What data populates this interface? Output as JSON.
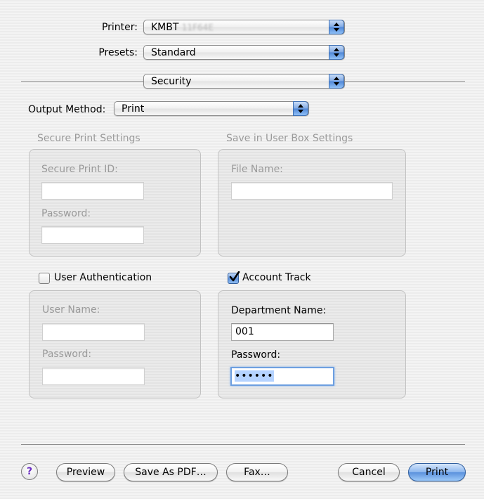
{
  "printer": {
    "label": "Printer:",
    "value": "KMBT",
    "value_redacted": "11F64E"
  },
  "presets": {
    "label": "Presets:",
    "value": "Standard"
  },
  "panel": {
    "value": "Security"
  },
  "output_method": {
    "label": "Output Method:",
    "value": "Print"
  },
  "secure_print": {
    "title": "Secure Print Settings",
    "id_label": "Secure Print ID:",
    "id_value": "",
    "password_label": "Password:",
    "password_value": ""
  },
  "user_box": {
    "title": "Save in User Box Settings",
    "file_name_label": "File Name:",
    "file_name_value": ""
  },
  "user_auth": {
    "label": "User Authentication",
    "checked": false,
    "user_name_label": "User Name:",
    "user_name_value": "",
    "password_label": "Password:",
    "password_value": ""
  },
  "account_track": {
    "label": "Account Track",
    "checked": true,
    "department_label": "Department Name:",
    "department_value": "001",
    "password_label": "Password:",
    "password_value": "••••••"
  },
  "buttons": {
    "help": "?",
    "preview": "Preview",
    "save_pdf": "Save As PDF…",
    "fax": "Fax…",
    "cancel": "Cancel",
    "print": "Print"
  },
  "icons": {
    "popup_arrows": "up-down-arrows-icon",
    "checkmark": "checkmark-icon",
    "help": "question-mark-icon"
  },
  "colors": {
    "accent": "#5b91dd",
    "disabled_text": "#9a9a9a"
  }
}
